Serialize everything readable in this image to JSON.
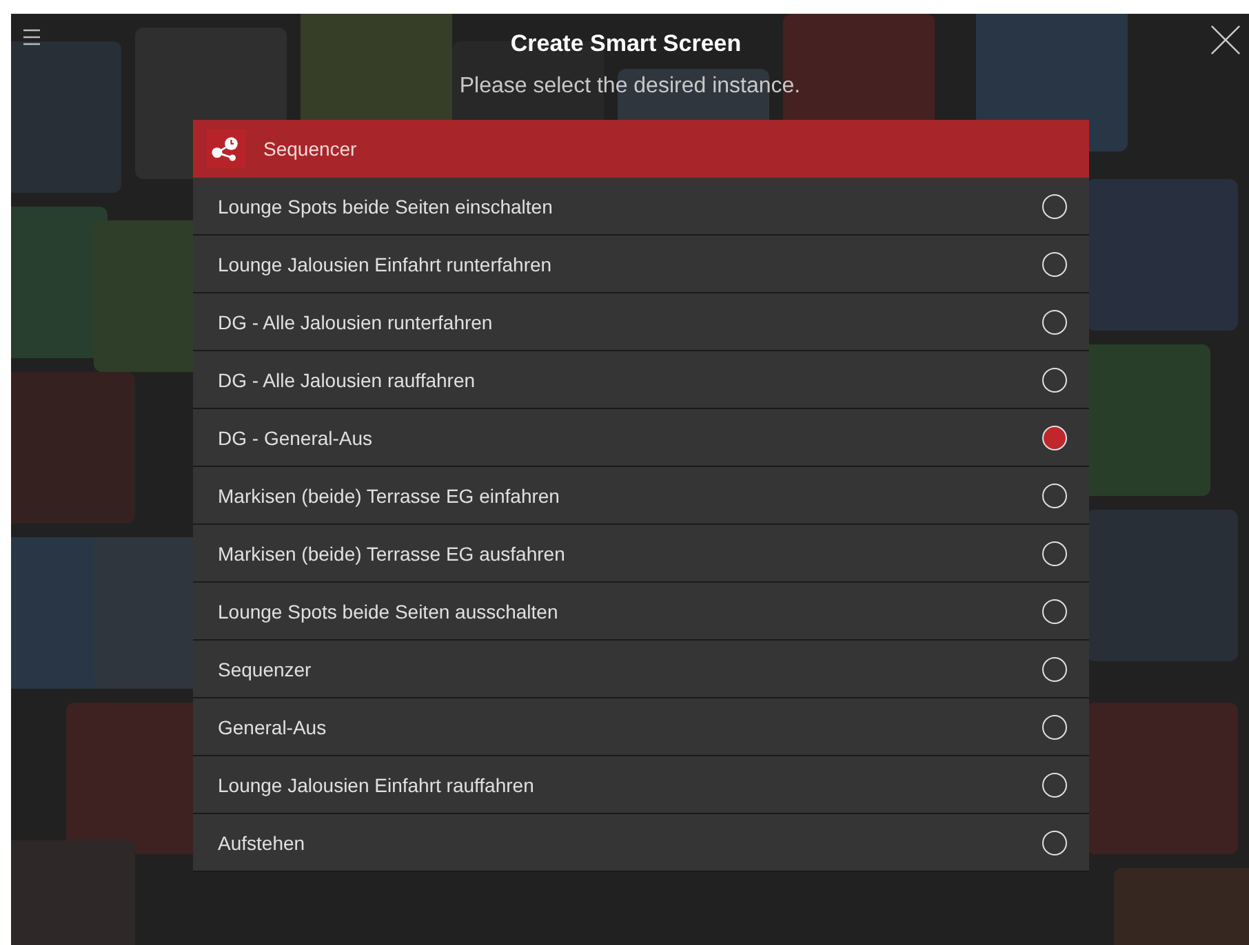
{
  "header": {
    "title": "Create Smart Screen",
    "subtitle": "Please select the desired instance."
  },
  "group": {
    "label": "Sequencer"
  },
  "instances": [
    {
      "label": "Lounge Spots beide Seiten einschalten",
      "selected": false
    },
    {
      "label": "Lounge Jalousien Einfahrt runterfahren",
      "selected": false
    },
    {
      "label": "DG - Alle Jalousien runterfahren",
      "selected": false
    },
    {
      "label": "DG - Alle Jalousien rauffahren",
      "selected": false
    },
    {
      "label": "DG - General-Aus",
      "selected": true
    },
    {
      "label": "Markisen (beide) Terrasse EG einfahren",
      "selected": false
    },
    {
      "label": "Markisen (beide) Terrasse EG ausfahren",
      "selected": false
    },
    {
      "label": "Lounge Spots beide Seiten ausschalten",
      "selected": false
    },
    {
      "label": "Sequenzer",
      "selected": false
    },
    {
      "label": "General-Aus",
      "selected": false
    },
    {
      "label": "Lounge Jalousien Einfahrt rauffahren",
      "selected": false
    },
    {
      "label": "Aufstehen",
      "selected": false
    }
  ]
}
